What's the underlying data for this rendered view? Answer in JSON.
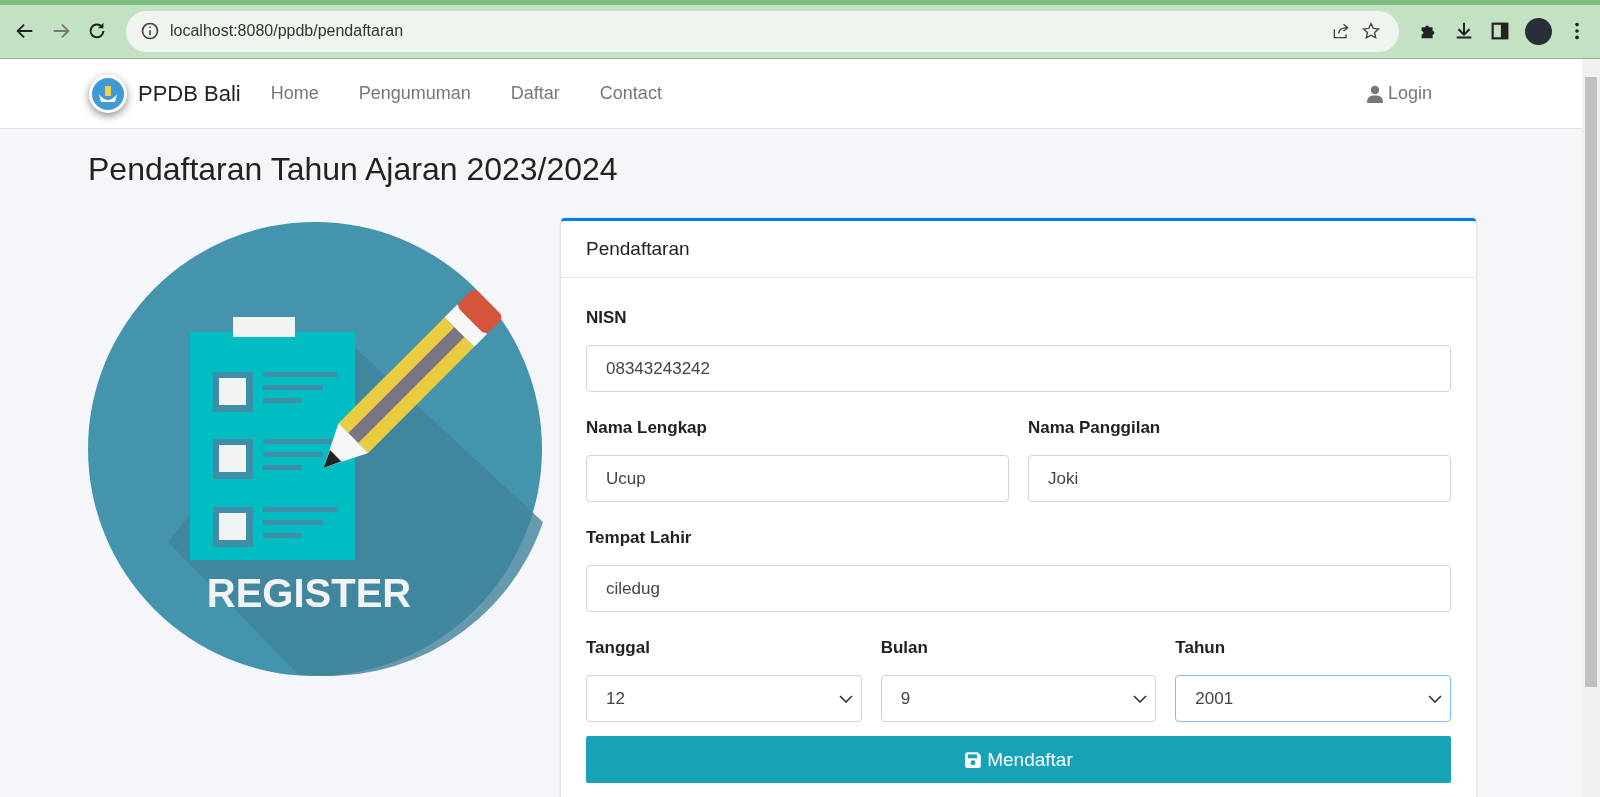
{
  "browser": {
    "url": "localhost:8080/ppdb/pendaftaran"
  },
  "navbar": {
    "brand": "PPDB Bali",
    "links": [
      "Home",
      "Pengumuman",
      "Daftar",
      "Contact"
    ],
    "login": "Login"
  },
  "page_title": "Pendaftaran Tahun Ajaran 2023/2024",
  "illustration": {
    "caption": "REGISTER"
  },
  "card": {
    "title": "Pendaftaran",
    "rows": [
      [
        {
          "kind": "input",
          "label": "NISN",
          "value": "08343243242"
        }
      ],
      [
        {
          "kind": "input",
          "label": "Nama Lengkap",
          "value": "Ucup"
        },
        {
          "kind": "input",
          "label": "Nama Panggilan",
          "value": "Joki"
        }
      ],
      [
        {
          "kind": "input",
          "label": "Tempat Lahir",
          "value": "ciledug"
        }
      ],
      [
        {
          "kind": "select",
          "label": "Tanggal",
          "value": "12",
          "focused": false
        },
        {
          "kind": "select",
          "label": "Bulan",
          "value": "9",
          "focused": false
        },
        {
          "kind": "select",
          "label": "Tahun",
          "value": "2001",
          "focused": true
        }
      ]
    ],
    "submit": "Mendaftar"
  }
}
